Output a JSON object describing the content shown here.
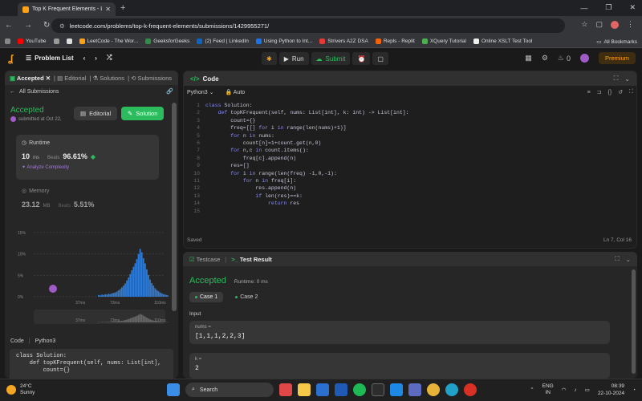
{
  "browser": {
    "tab_title": "Top K Frequent Elements - Leet",
    "url": "leetcode.com/problems/top-k-frequent-elements/submissions/1429955271/",
    "bookmarks": [
      "YouTube",
      "LeetCode - The Wor...",
      "GeeksforGeeks",
      "(2) Feed | LinkedIn",
      "Using Python to Int...",
      "Strivers A2Z DSA",
      "Repls - Replit",
      "XQuery Tutorial",
      "Online XSLT Test Tool"
    ],
    "all_bookmarks": "All Bookmarks"
  },
  "header": {
    "problem_list": "Problem List",
    "run": "Run",
    "submit": "Submit",
    "coins": "0",
    "premium": "Premium"
  },
  "left": {
    "tabs": [
      "Accepted",
      "Editorial",
      "Solutions",
      "Submissions"
    ],
    "all_submissions": "All Submissions",
    "status": "Accepted",
    "submitted_by": "submitted at Oct 22,",
    "editorial_btn": "Editorial",
    "solution_btn": "Solution",
    "runtime": {
      "label": "Runtime",
      "value": "10",
      "unit": "ms",
      "beats_label": "Beats",
      "beats": "96.61%",
      "analyze": "Analyze Complexity"
    },
    "memory": {
      "label": "Memory",
      "value": "23.12",
      "unit": "MB",
      "beats_label": "Beats",
      "beats": "5.51%"
    },
    "code_label": "Code",
    "lang": "Python3",
    "snippet": "class Solution:\n    def topKFrequent(self, nums: List[int],\n        count={}"
  },
  "chart_data": {
    "type": "bar",
    "y_ticks": [
      "15%",
      "10%",
      "5%",
      "0%"
    ],
    "x_ticks": [
      "37ms",
      "73ms",
      "110ms"
    ],
    "ylim": [
      0,
      15
    ],
    "values": [
      0.4,
      0.3,
      0.5,
      0.4,
      0.6,
      0.5,
      0.7,
      0.6,
      0.8,
      0.9,
      1.0,
      1.2,
      1.5,
      1.8,
      2.2,
      2.6,
      3.1,
      3.8,
      4.5,
      5.3,
      6.2,
      7.0,
      7.8,
      8.8,
      10.0,
      11.2,
      10.4,
      9.0,
      7.8,
      6.4,
      5.1,
      4.0,
      3.2,
      2.6,
      2.0,
      1.6,
      1.3,
      1.0,
      0.8,
      0.6,
      0.5,
      0.4,
      0.3,
      0.3,
      0.2
    ]
  },
  "editor": {
    "title": "Code",
    "lang": "Python3",
    "mode": "Auto",
    "saved": "Saved",
    "cursor": "Ln 7, Col 16",
    "lines": [
      "class Solution:",
      "    def topKFrequent(self, nums: List[int], k: int) -> List[int]:",
      "        count={}",
      "        freq=[[] for i in range(len(nums)+1)]",
      "        for n in nums:",
      "            count[n]=1+count.get(n,0)",
      "        for n,c in count.items():",
      "            freq[c].append(n)",
      "        res=[]",
      "        for i in range(len(freq) -1,0,-1):",
      "            for n in freq[i]:",
      "                res.append(n)",
      "                if len(res)==k:",
      "                    return res",
      ""
    ]
  },
  "test": {
    "tabs": [
      "Testcase",
      "Test Result"
    ],
    "status": "Accepted",
    "runtime": "Runtime: 0 ms",
    "cases": [
      "Case 1",
      "Case 2"
    ],
    "input_label": "Input",
    "inputs": [
      {
        "name": "nums =",
        "value": "[1,1,1,2,2,3]"
      },
      {
        "name": "k =",
        "value": "2"
      }
    ]
  },
  "taskbar": {
    "temp": "24°C",
    "weather": "Sunny",
    "search": "Search",
    "lang": "ENG",
    "region": "IN",
    "time": "08:39",
    "date": "22-10-2024"
  }
}
